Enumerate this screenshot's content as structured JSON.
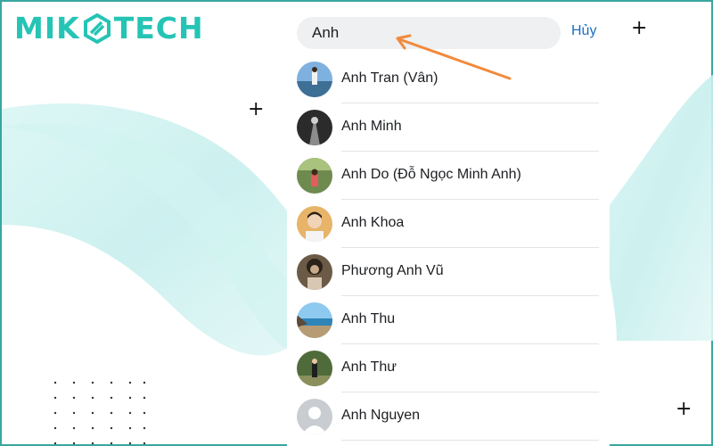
{
  "brand": {
    "part1": "MIK",
    "part2": "TECH",
    "color": "#25c4b5"
  },
  "search": {
    "value": "Anh",
    "cancel_label": "Hủy"
  },
  "results": [
    {
      "name": "Anh Tran (Vân)",
      "avatar": "avatar-photo-beach"
    },
    {
      "name": "Anh Minh",
      "avatar": "avatar-photo-dark"
    },
    {
      "name": "Anh Do (Đỗ Ngọc Minh Anh)",
      "avatar": "avatar-photo-forest"
    },
    {
      "name": "Anh Khoa",
      "avatar": "avatar-photo-portrait"
    },
    {
      "name": "Phương Anh Vũ",
      "avatar": "avatar-photo-sepia"
    },
    {
      "name": "Anh Thu",
      "avatar": "avatar-photo-sea"
    },
    {
      "name": "Anh Thư",
      "avatar": "avatar-photo-park"
    },
    {
      "name": "Anh Nguyen",
      "avatar": "default-avatar-icon"
    }
  ],
  "colors": {
    "accent": "#1a6fc2",
    "arrow": "#f28a3c",
    "wave": "#bfeeee"
  }
}
